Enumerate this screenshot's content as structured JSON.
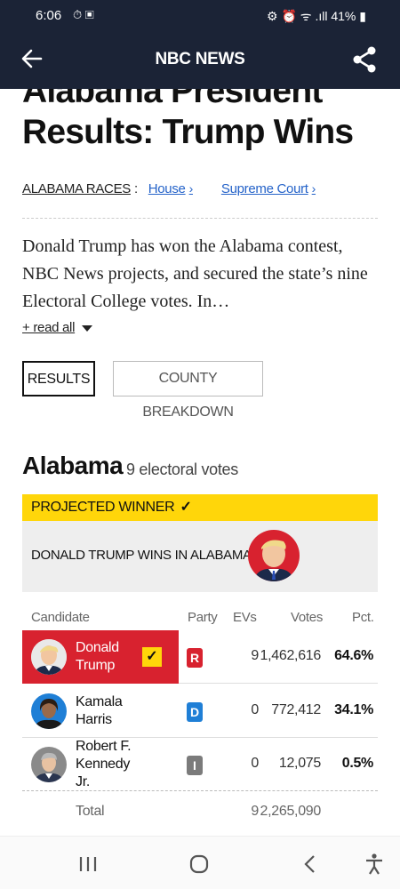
{
  "status_bar": {
    "time": "6:06",
    "battery": "41%"
  },
  "app_bar": {
    "title": "NBC NEWS"
  },
  "article": {
    "headline": "Alabama President Results: Trump Wins",
    "races_label": "ALABAMA RACES",
    "races_colon": ":",
    "race_links": [
      "House",
      "Supreme Court"
    ],
    "summary": "Donald Trump has won the Alabama contest, NBC News projects, and secured the state’s nine Electoral College votes. In…",
    "read_all": "+ read all"
  },
  "tabs": [
    "RESULTS",
    "COUNTY BREAKDOWN"
  ],
  "state_header": {
    "name": "Alabama",
    "ev_label": "9 electoral votes"
  },
  "winner": {
    "banner": "PROJECTED WINNER",
    "text": "DONALD TRUMP WINS IN ALABAMA"
  },
  "table": {
    "headers": {
      "candidate": "Candidate",
      "party": "Party",
      "evs": "EVs",
      "votes": "Votes",
      "pct": "Pct."
    },
    "rows": [
      {
        "name": "Donald Trump",
        "party": "R",
        "evs": "9",
        "votes": "1,462,616",
        "pct": "64.6%"
      },
      {
        "name": "Kamala Harris",
        "party": "D",
        "evs": "0",
        "votes": "772,412",
        "pct": "34.1%"
      },
      {
        "name": "Robert F. Kennedy Jr.",
        "party": "I",
        "evs": "0",
        "votes": "12,075",
        "pct": "0.5%"
      }
    ],
    "total": {
      "label": "Total",
      "evs": "9",
      "votes": "2,265,090"
    }
  },
  "colors": {
    "nav": "#1b2336",
    "republican": "#d8222f",
    "democrat": "#1f7fd6",
    "independent": "#7b7b7b",
    "winner_yellow": "#ffd60a",
    "link": "#2563c9"
  }
}
